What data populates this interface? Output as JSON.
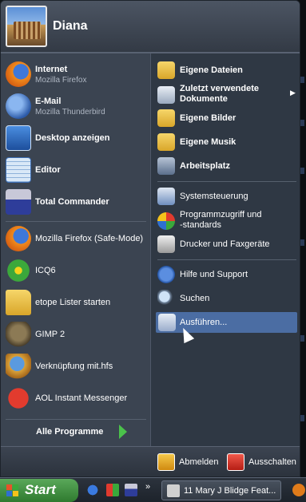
{
  "user": {
    "name": "Diana"
  },
  "pinned": [
    {
      "label": "Internet",
      "sub": "Mozilla Firefox",
      "icon": "firefox-icon"
    },
    {
      "label": "E-Mail",
      "sub": "Mozilla Thunderbird",
      "icon": "thunderbird-icon"
    }
  ],
  "recent": [
    {
      "label": "Desktop anzeigen",
      "icon": "show-desktop-icon"
    },
    {
      "label": "Editor",
      "icon": "notepad-icon"
    },
    {
      "label": "Total Commander",
      "icon": "floppy-disk-icon"
    },
    {
      "label": "Mozilla Firefox (Safe-Mode)",
      "icon": "firefox-icon"
    },
    {
      "label": "ICQ6",
      "icon": "icq-flower-icon"
    },
    {
      "label": "etope Lister starten",
      "icon": "folder-arrow-icon"
    },
    {
      "label": "GIMP 2",
      "icon": "gimp-icon"
    },
    {
      "label": "Verknüpfung mit.hfs",
      "icon": "hfs-server-icon"
    },
    {
      "label": "AOL Instant Messenger",
      "icon": "aim-icon"
    }
  ],
  "all_programs": {
    "label": "Alle Programme"
  },
  "right": {
    "eigene_dateien": "Eigene Dateien",
    "zuletzt_line1": "Zuletzt verwendete",
    "zuletzt_line2": "Dokumente",
    "eigene_bilder": "Eigene Bilder",
    "eigene_musik": "Eigene Musik",
    "arbeitsplatz": "Arbeitsplatz",
    "systemsteuerung": "Systemsteuerung",
    "programmzugriff_line1": "Programmzugriff und",
    "programmzugriff_line2": "-standards",
    "drucker": "Drucker und Faxgeräte",
    "hilfe": "Hilfe und Support",
    "suchen": "Suchen",
    "ausfuehren": "Ausführen..."
  },
  "footer": {
    "logoff": "Abmelden",
    "shutdown": "Ausschalten"
  },
  "taskbar": {
    "start": "Start",
    "chevron": "»",
    "task_label": "11 Mary J Blidge Feat..."
  },
  "colors": {
    "highlight": "#4b6da3",
    "pane_left": "#3b4451",
    "pane_right": "#2f3844",
    "start_green": "#3d8f3d"
  }
}
